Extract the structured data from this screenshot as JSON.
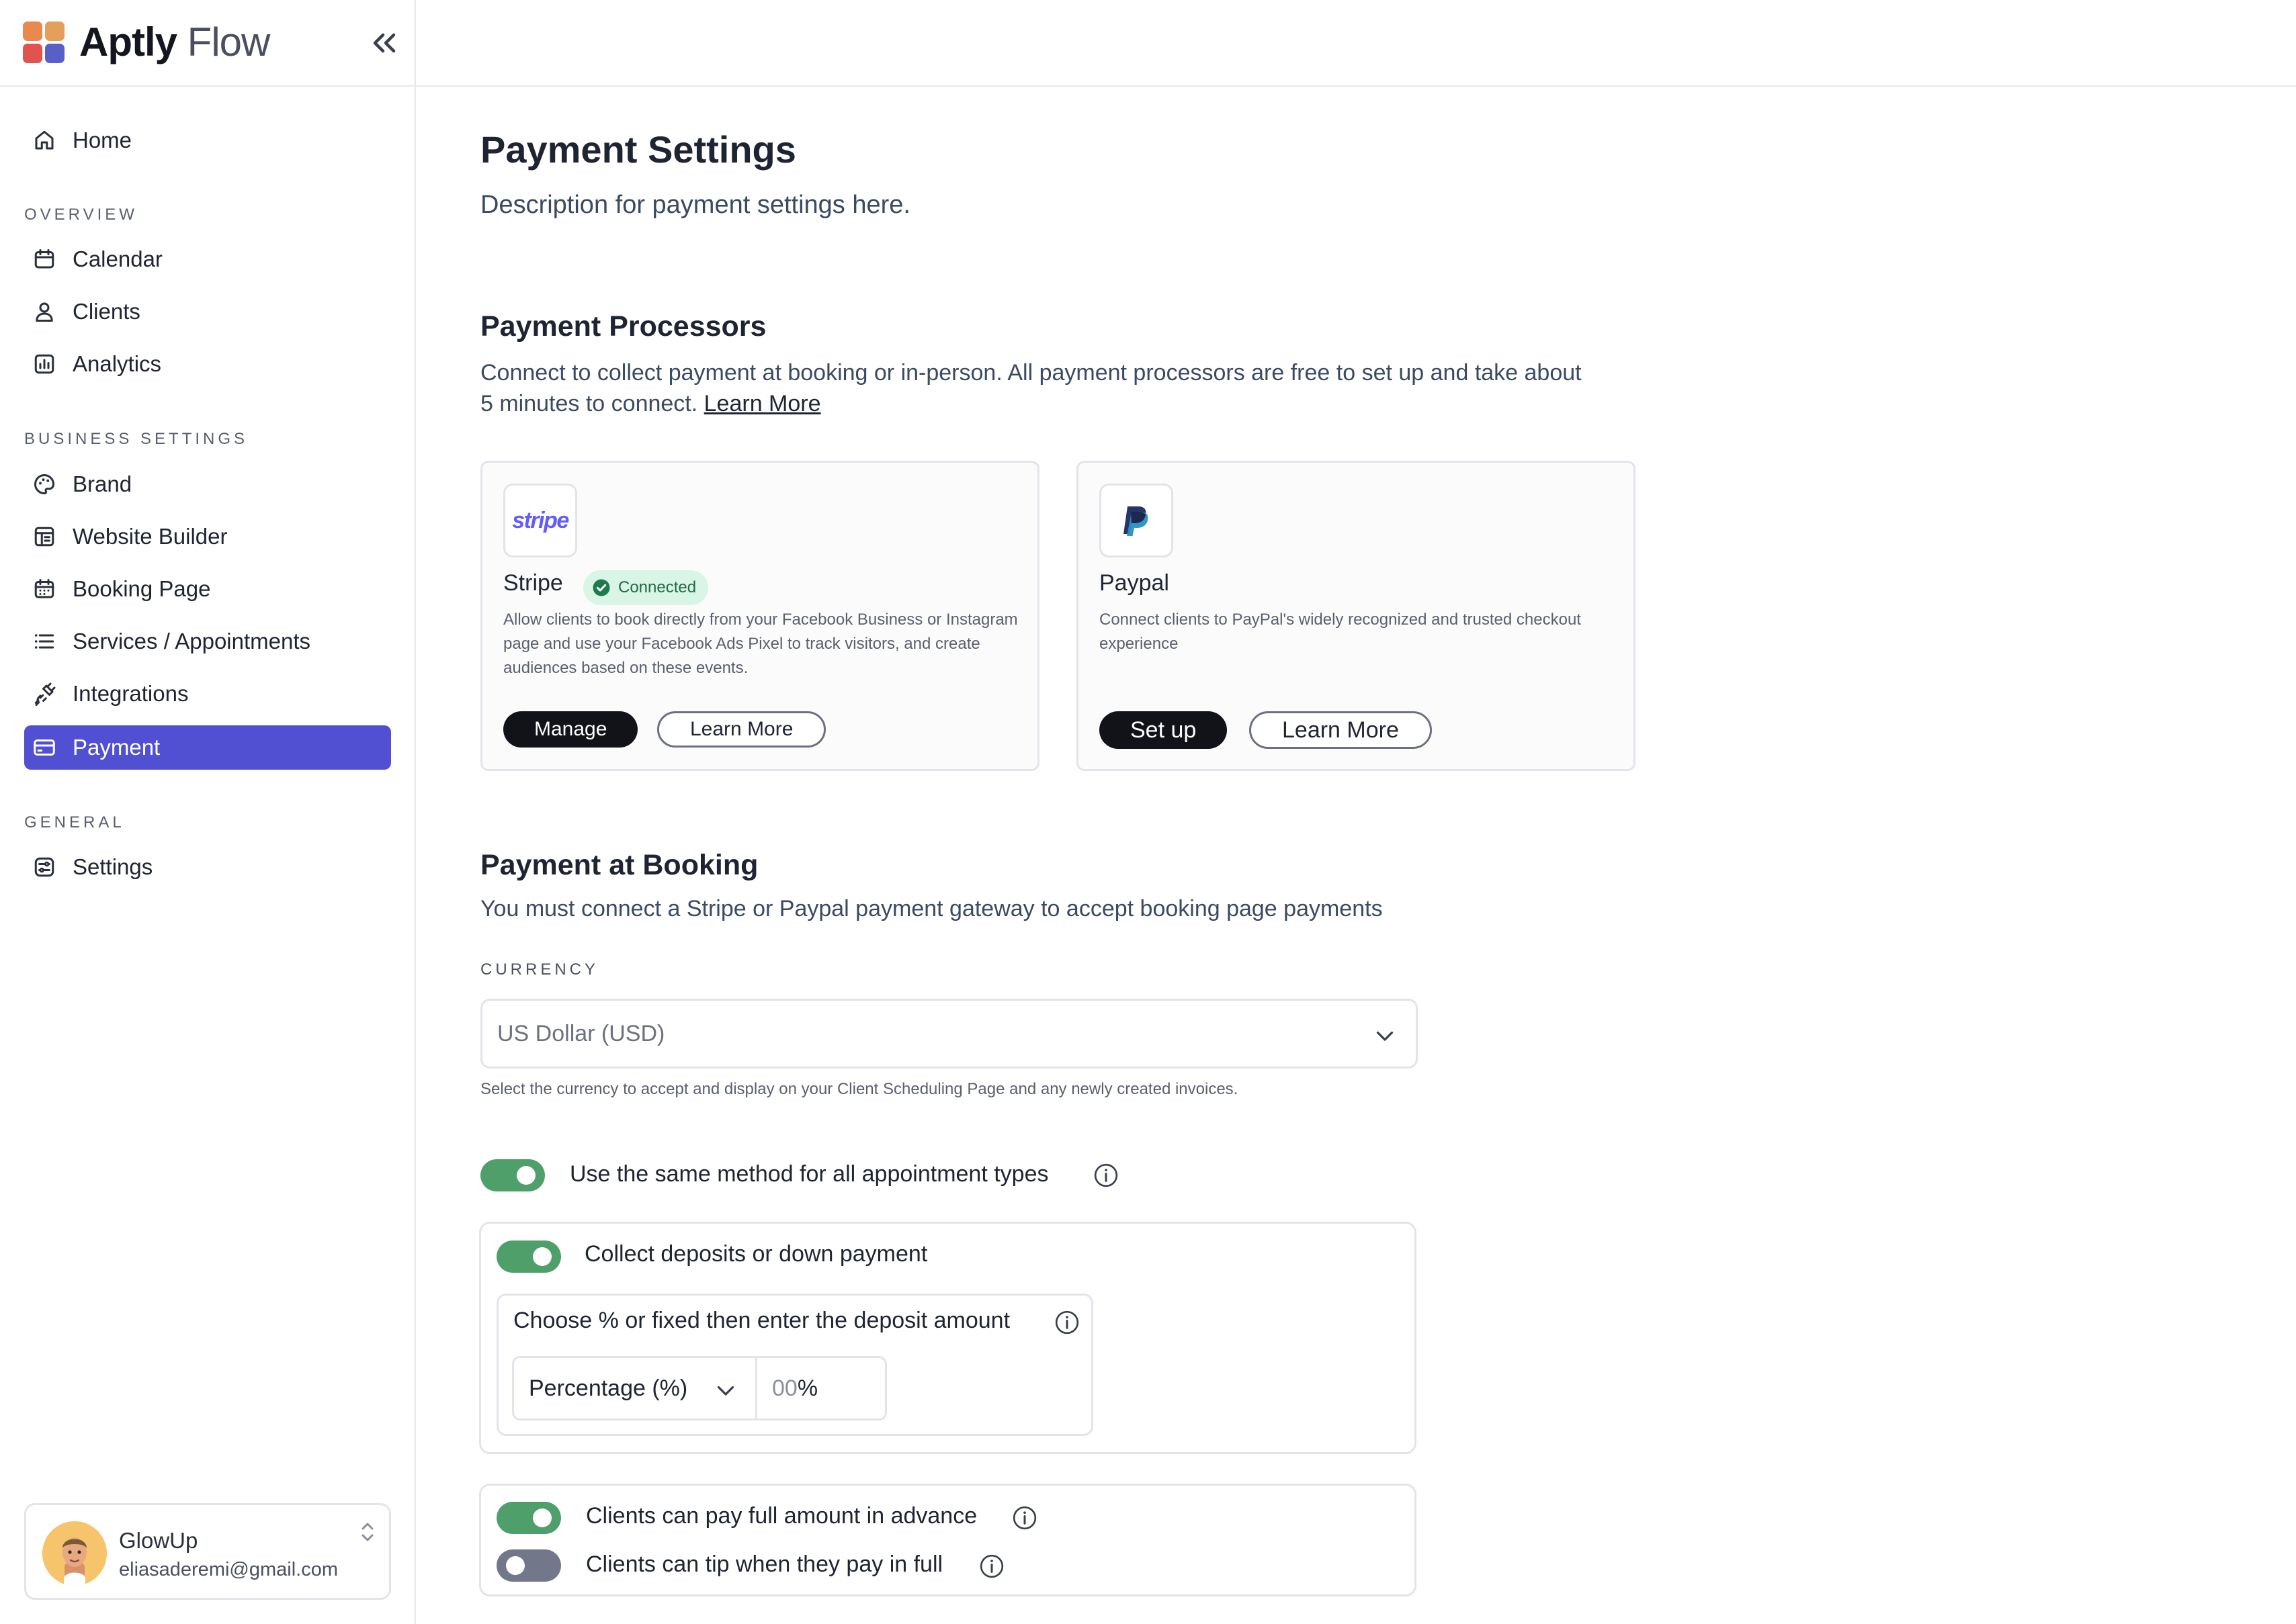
{
  "brand": {
    "name_bold": "Aptly",
    "name_light": "Flow"
  },
  "sidebar": {
    "home": "Home",
    "sections": {
      "overview": "OVERVIEW",
      "business": "BUSINESS SETTINGS",
      "general": "GENERAL"
    },
    "overview_items": [
      "Calendar",
      "Clients",
      "Analytics"
    ],
    "business_items": [
      "Brand",
      "Website Builder",
      "Booking Page",
      "Services / Appointments",
      "Integrations",
      "Payment"
    ],
    "general_items": [
      "Settings"
    ],
    "active_item": "Payment",
    "user": {
      "name": "GlowUp",
      "email": "eliasaderemi@gmail.com"
    }
  },
  "page": {
    "title": "Payment Settings",
    "description": "Description for payment settings here."
  },
  "processors": {
    "title": "Payment Processors",
    "text": "Connect to collect payment at booking or in-person. All payment processors are free to set up and take about 5 minutes to connect.",
    "learn_more": "Learn More",
    "stripe": {
      "logo_text": "stripe",
      "name": "Stripe",
      "badge": "Connected",
      "description": "Allow clients to book directly from your Facebook Business or Instagram  page and use your Facebook Ads Pixel to track visitors, and create  audiences based on these events.",
      "primary_button": "Manage",
      "secondary_button": "Learn More"
    },
    "paypal": {
      "name": "Paypal",
      "description": "Connect clients to PayPal's widely recognized and trusted checkout experience",
      "primary_button": "Set up",
      "secondary_button": "Learn More"
    }
  },
  "booking": {
    "title": "Payment at Booking",
    "text": "You must connect a Stripe or Paypal payment gateway to accept booking page payments",
    "currency_label": "CURRENCY",
    "currency_value": "US Dollar (USD)",
    "currency_help": "Select the currency to accept and display on your Client Scheduling Page and any newly created invoices.",
    "same_method_label": "Use the same method for all appointment types",
    "same_method_on": true,
    "deposit_label": "Collect deposits or down payment",
    "deposit_on": true,
    "deposit_choose_label": "Choose % or fixed then enter the deposit amount",
    "deposit_type": "Percentage (%)",
    "deposit_placeholder": "00",
    "deposit_suffix": "%",
    "full_amount_label": "Clients can pay full amount in advance",
    "full_amount_on": true,
    "tip_label": "Clients can tip when they pay in full",
    "tip_on": false
  },
  "colors": {
    "accent": "#5150d3",
    "toggle_on": "#4f9f6a",
    "toggle_off": "#727789",
    "badge_bg": "#d8f5e5",
    "stripe_brand": "#635bff"
  },
  "icons": {
    "home": "home-icon",
    "calendar": "calendar-icon",
    "clients": "user-icon",
    "analytics": "chart-icon",
    "brand": "palette-icon",
    "website": "layout-icon",
    "booking": "calendar-grid-icon",
    "services": "list-icon",
    "integrations": "plug-icon",
    "payment": "credit-card-icon",
    "settings": "settings-icon"
  }
}
